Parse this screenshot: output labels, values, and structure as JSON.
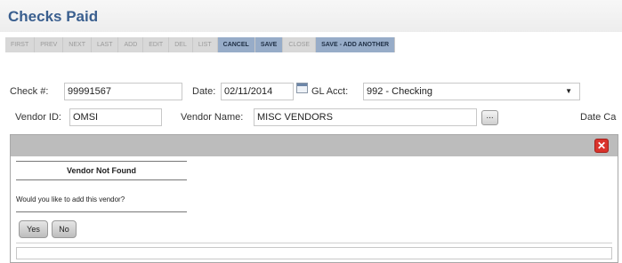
{
  "header": {
    "title": "Checks Paid"
  },
  "toolbar": {
    "buttons": [
      {
        "label": "FIRST",
        "state": "disabled"
      },
      {
        "label": "PREV",
        "state": "disabled"
      },
      {
        "label": "NEXT",
        "state": "disabled"
      },
      {
        "label": "LAST",
        "state": "disabled"
      },
      {
        "label": "ADD",
        "state": "disabled"
      },
      {
        "label": "EDIT",
        "state": "disabled"
      },
      {
        "label": "DEL",
        "state": "disabled"
      },
      {
        "label": "LIST",
        "state": "disabled"
      },
      {
        "label": "CANCEL",
        "state": "enabled"
      },
      {
        "label": "SAVE",
        "state": "enabled"
      },
      {
        "label": "CLOSE",
        "state": "disabled"
      },
      {
        "label": "SAVE - ADD ANOTHER",
        "state": "enabled"
      }
    ]
  },
  "form": {
    "check_label": "Check #:",
    "check_value": "99991567",
    "date_label": "Date:",
    "date_value": "02/11/2014",
    "gl_label": "GL Acct:",
    "gl_value": "992 - Checking",
    "vendor_id_label": "Vendor ID:",
    "vendor_id_value": "OMSI",
    "vendor_name_label": "Vendor Name:",
    "vendor_name_value": "MISC VENDORS",
    "lookup_label": "...",
    "date_ca_label": "Date Ca"
  },
  "dialog": {
    "close_glyph": "✕",
    "title": "Vendor Not Found",
    "question": "Would you like to add this vendor?",
    "yes_label": "Yes",
    "no_label": "No"
  },
  "colors": {
    "title": "#3a5f8f",
    "toolbar_enabled": "#97acc8",
    "toolbar_disabled": "#d8d8d8",
    "dialog_bar": "#bcbcbc",
    "close_button": "#d9322b"
  }
}
